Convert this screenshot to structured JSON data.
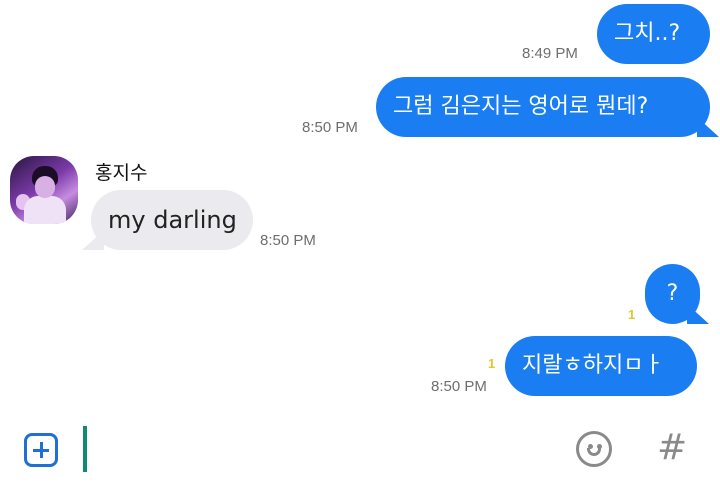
{
  "messages": [
    {
      "text": "그치..?",
      "time": "8:49 PM"
    },
    {
      "text": "그럼 김은지는 영어로 뭔데?",
      "time": "8:50 PM"
    },
    {
      "sender": "홍지수",
      "text": "my darling",
      "time": "8:50 PM"
    },
    {
      "text": "?",
      "unread": "1"
    },
    {
      "text": "지랄ㅎ하지ㅁㅏ",
      "unread": "1",
      "time": "8:50 PM"
    }
  ],
  "input": {
    "value": ""
  },
  "icons": {
    "attach": "plus-square-icon",
    "emoji": "smiley-icon",
    "hashtag": "hash-icon"
  },
  "colors": {
    "outgoing_bubble": "#1a7ef2",
    "incoming_bubble": "#ebebef",
    "unread_count": "#e4c72c",
    "cursor": "#0f8a75"
  }
}
